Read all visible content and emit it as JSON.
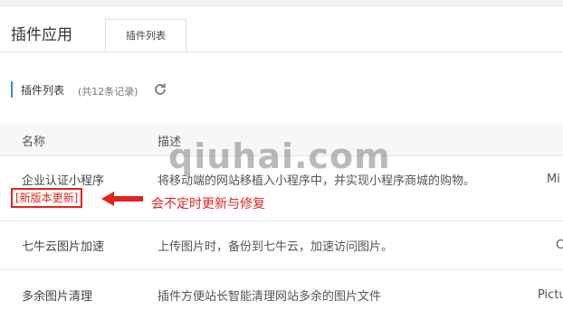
{
  "header": {
    "title": "插件应用",
    "tab_label": "插件列表"
  },
  "section": {
    "title": "插件列表",
    "record_count": "(共12条记录)"
  },
  "table": {
    "columns": [
      "名称",
      "描述"
    ],
    "rows": [
      {
        "name": "企业认证小程序",
        "description": "将移动端的网站移植入小程序中，并实现小程序商城的购物。",
        "extra": "Mi",
        "badge": "[新版本更新]"
      },
      {
        "name": "七牛云图片加速",
        "description": "上传图片时，备份到七牛云，加速访问图片。",
        "extra": "C"
      },
      {
        "name": "多余图片清理",
        "description": "插件方便站长智能清理网站多余的图片文件",
        "extra": "Pictu"
      }
    ]
  },
  "annotation": {
    "text": "会不定时更新与修复",
    "color": "#e2241f"
  },
  "watermark": {
    "text": "qiuhai.com"
  },
  "colors": {
    "accent": "#2f8fd9",
    "highlight": "#e2241f"
  }
}
